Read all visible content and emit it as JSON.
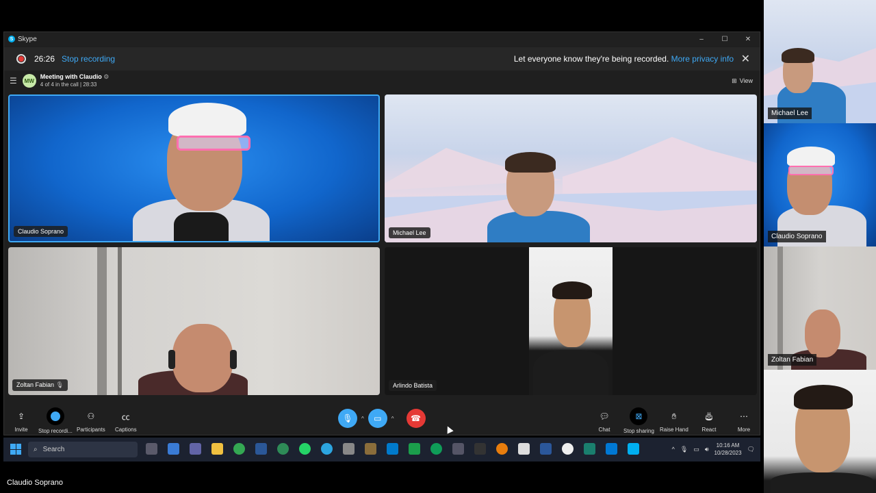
{
  "window": {
    "title": "Skype",
    "controls": {
      "minimize": "–",
      "maximize": "☐",
      "close": "✕"
    }
  },
  "recording": {
    "time": "26:26",
    "stop_label": "Stop recording",
    "notice": "Let everyone know they're being recorded.",
    "privacy_link": "More privacy info"
  },
  "meeting": {
    "initials": "MW",
    "title": "Meeting with Claudio",
    "subtitle": "4 of 4 in the call | 28:33",
    "view_label": "View"
  },
  "participants": [
    {
      "name": "Claudio Soprano"
    },
    {
      "name": "Michael Lee"
    },
    {
      "name": "Zoltan Fabian"
    },
    {
      "name": "Arlindo Batista"
    }
  ],
  "controls_left": [
    {
      "label": "Invite",
      "icon": "share-icon"
    },
    {
      "label": "Stop recordi...",
      "icon": "record-icon"
    },
    {
      "label": "Participants",
      "icon": "participants-icon"
    },
    {
      "label": "Captions",
      "icon": "captions-icon"
    }
  ],
  "controls_right": [
    {
      "label": "Chat",
      "icon": "chat-icon"
    },
    {
      "label": "Stop sharing",
      "icon": "stop-sharing-icon"
    },
    {
      "label": "Raise Hand",
      "icon": "hand-icon"
    },
    {
      "label": "React",
      "icon": "react-icon"
    },
    {
      "label": "More",
      "icon": "more-icon"
    }
  ],
  "taskbar": {
    "search_placeholder": "Search",
    "time": "10:16 AM",
    "date": "10/28/2023"
  },
  "speaker_caption": "Claudio Soprano",
  "sidebar_videos": [
    {
      "name": "Michael Lee"
    },
    {
      "name": "Claudio Soprano"
    },
    {
      "name": "Zoltan Fabian"
    },
    {
      "name": ""
    }
  ],
  "colors": {
    "accent": "#3fa9f5",
    "end_call": "#e53935",
    "window_bg": "#1f1f1f"
  }
}
